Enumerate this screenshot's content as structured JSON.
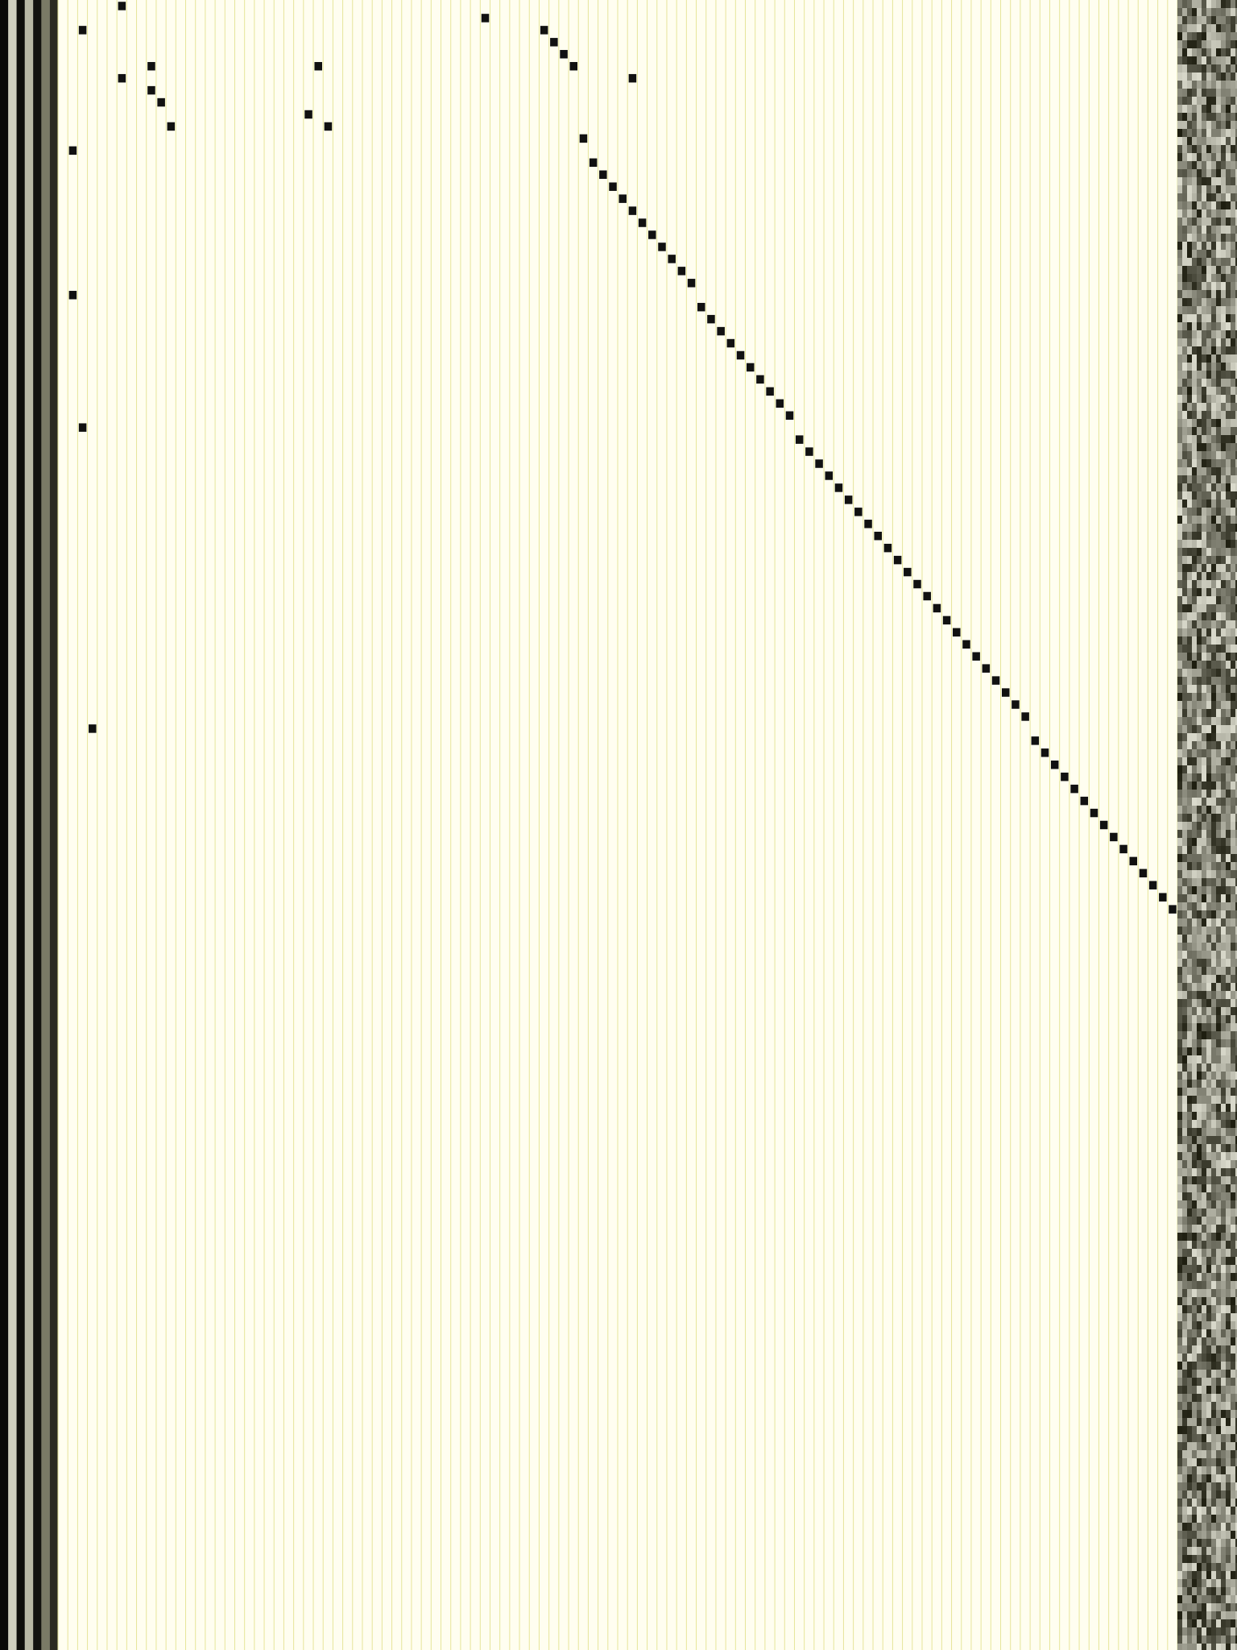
{
  "colors": {
    "background": "#FFFEF0",
    "gridline": "#E6E59A",
    "cell": "#111111"
  },
  "left_strip": {
    "description_none": true,
    "rails": [
      {
        "index": 0,
        "tone": "#0A0A08"
      },
      {
        "index": 1,
        "tone": "#CFCFBE"
      },
      {
        "index": 2,
        "tone": "#0E0E0A"
      },
      {
        "index": 3,
        "tone": "#B9B9A5"
      },
      {
        "index": 4,
        "tone": "#13130F"
      },
      {
        "index": 5,
        "tone": "#7A7A66"
      },
      {
        "index": 6,
        "tone": "#2B2B22"
      }
    ]
  },
  "grid": {
    "columns": 114,
    "rows": 137
  },
  "active_cells": [
    [
      0,
      6
    ],
    [
      1,
      43
    ],
    [
      2,
      2
    ],
    [
      2,
      49
    ],
    [
      3,
      50
    ],
    [
      4,
      51
    ],
    [
      5,
      9
    ],
    [
      5,
      26
    ],
    [
      5,
      52
    ],
    [
      6,
      6
    ],
    [
      6,
      58
    ],
    [
      7,
      9
    ],
    [
      8,
      10
    ],
    [
      9,
      25
    ],
    [
      10,
      11
    ],
    [
      10,
      27
    ],
    [
      11,
      53
    ],
    [
      12,
      1
    ],
    [
      13,
      54
    ],
    [
      14,
      55
    ],
    [
      15,
      56
    ],
    [
      16,
      57
    ],
    [
      17,
      58
    ],
    [
      18,
      59
    ],
    [
      19,
      60
    ],
    [
      20,
      61
    ],
    [
      21,
      62
    ],
    [
      22,
      63
    ],
    [
      23,
      64
    ],
    [
      24,
      1
    ],
    [
      25,
      65
    ],
    [
      26,
      66
    ],
    [
      27,
      67
    ],
    [
      28,
      68
    ],
    [
      29,
      69
    ],
    [
      30,
      70
    ],
    [
      31,
      71
    ],
    [
      32,
      72
    ],
    [
      33,
      73
    ],
    [
      34,
      74
    ],
    [
      35,
      2
    ],
    [
      36,
      75
    ],
    [
      37,
      76
    ],
    [
      38,
      77
    ],
    [
      39,
      78
    ],
    [
      40,
      79
    ],
    [
      41,
      80
    ],
    [
      42,
      81
    ],
    [
      43,
      82
    ],
    [
      44,
      83
    ],
    [
      45,
      84
    ],
    [
      46,
      85
    ],
    [
      47,
      86
    ],
    [
      48,
      87
    ],
    [
      49,
      88
    ],
    [
      50,
      89
    ],
    [
      51,
      90
    ],
    [
      52,
      91
    ],
    [
      53,
      92
    ],
    [
      54,
      93
    ],
    [
      55,
      94
    ],
    [
      56,
      95
    ],
    [
      57,
      96
    ],
    [
      58,
      97
    ],
    [
      59,
      98
    ],
    [
      60,
      3
    ],
    [
      61,
      99
    ],
    [
      62,
      100
    ],
    [
      63,
      101
    ],
    [
      64,
      102
    ],
    [
      65,
      103
    ],
    [
      66,
      104
    ],
    [
      67,
      105
    ],
    [
      68,
      106
    ],
    [
      69,
      107
    ],
    [
      70,
      108
    ],
    [
      71,
      109
    ],
    [
      72,
      110
    ],
    [
      73,
      111
    ],
    [
      74,
      112
    ],
    [
      75,
      113
    ]
  ]
}
